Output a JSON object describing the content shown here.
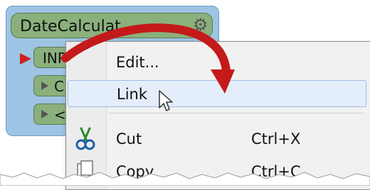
{
  "node": {
    "title": "DateCalculat",
    "input_port_label": "INP",
    "port2_label": "C",
    "port3_label": "<",
    "gear_icon": "gear-icon"
  },
  "menu": {
    "items": [
      {
        "label": "Edit...",
        "shortcut": ""
      },
      {
        "label": "Link",
        "shortcut": ""
      },
      {
        "label": "Cut",
        "shortcut": "Ctrl+X",
        "icon": "scissors-icon"
      },
      {
        "label": "Copy",
        "shortcut": "Ctrl+C",
        "icon": "copy-icon"
      }
    ]
  },
  "colors": {
    "node_background": "#9ec4e4",
    "node_title": "#8ab07c",
    "arrow": "#c41a1a",
    "menu_hover": "#e4eefb",
    "input_marker": "#cc2222"
  }
}
